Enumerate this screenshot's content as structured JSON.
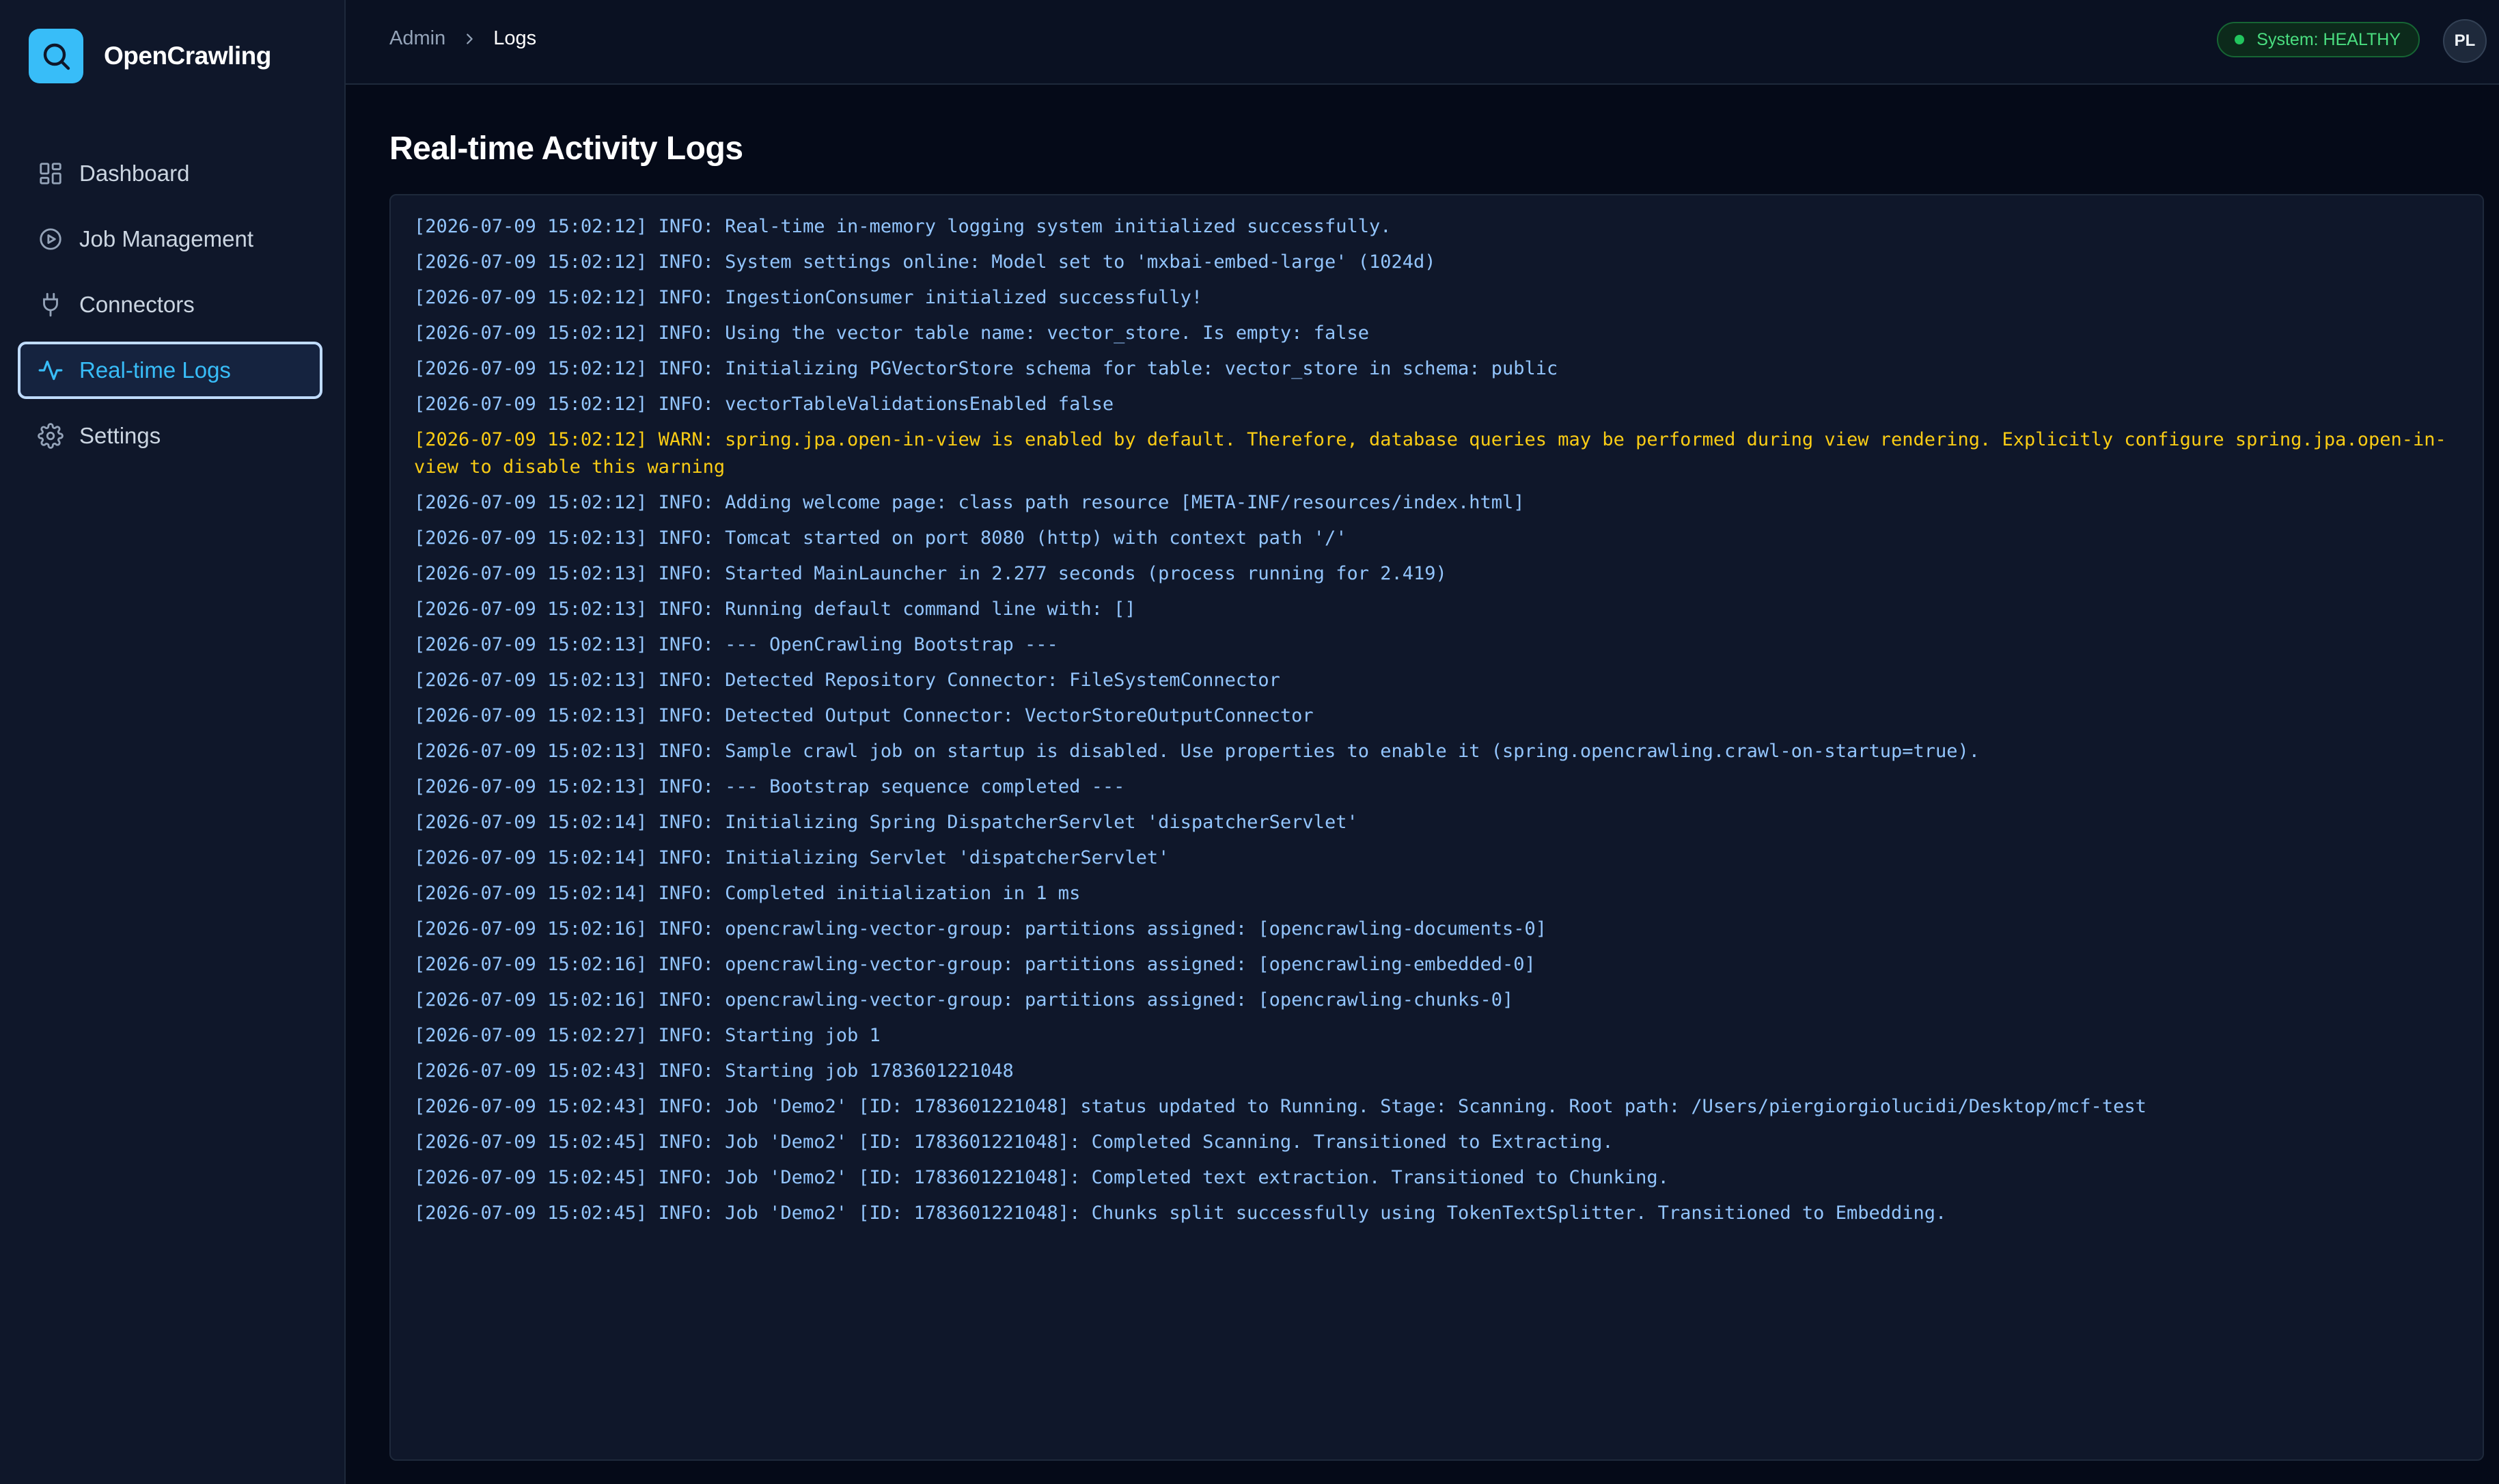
{
  "app": {
    "name": "OpenCrawling",
    "logo_icon": "search-icon",
    "accent_color": "#38bdf8"
  },
  "sidebar": {
    "items": [
      {
        "label": "Dashboard",
        "icon": "dashboard-icon",
        "active": false
      },
      {
        "label": "Job Management",
        "icon": "play-circle-icon",
        "active": false
      },
      {
        "label": "Connectors",
        "icon": "plug-icon",
        "active": false
      },
      {
        "label": "Real-time Logs",
        "icon": "activity-icon",
        "active": true
      },
      {
        "label": "Settings",
        "icon": "gear-icon",
        "active": false
      }
    ]
  },
  "header": {
    "breadcrumb": {
      "parent": "Admin",
      "current": "Logs"
    },
    "status": {
      "label": "System: HEALTHY",
      "color": "#22c55e"
    },
    "avatar_initials": "PL"
  },
  "main": {
    "title": "Real-time Activity Logs"
  },
  "logs": [
    {
      "level": "INFO",
      "text": "[2026-07-09 15:02:12] INFO: Real-time in-memory logging system initialized successfully."
    },
    {
      "level": "INFO",
      "text": "[2026-07-09 15:02:12] INFO: System settings online: Model set to 'mxbai-embed-large' (1024d)"
    },
    {
      "level": "INFO",
      "text": "[2026-07-09 15:02:12] INFO: IngestionConsumer initialized successfully!"
    },
    {
      "level": "INFO",
      "text": "[2026-07-09 15:02:12] INFO: Using the vector table name: vector_store. Is empty: false"
    },
    {
      "level": "INFO",
      "text": "[2026-07-09 15:02:12] INFO: Initializing PGVectorStore schema for table: vector_store in schema: public"
    },
    {
      "level": "INFO",
      "text": "[2026-07-09 15:02:12] INFO: vectorTableValidationsEnabled false"
    },
    {
      "level": "WARN",
      "text": "[2026-07-09 15:02:12] WARN: spring.jpa.open-in-view is enabled by default. Therefore, database queries may be performed during view rendering. Explicitly configure spring.jpa.open-in-view to disable this warning"
    },
    {
      "level": "INFO",
      "text": "[2026-07-09 15:02:12] INFO: Adding welcome page: class path resource [META-INF/resources/index.html]"
    },
    {
      "level": "INFO",
      "text": "[2026-07-09 15:02:13] INFO: Tomcat started on port 8080 (http) with context path '/'"
    },
    {
      "level": "INFO",
      "text": "[2026-07-09 15:02:13] INFO: Started MainLauncher in 2.277 seconds (process running for 2.419)"
    },
    {
      "level": "INFO",
      "text": "[2026-07-09 15:02:13] INFO: Running default command line with: []"
    },
    {
      "level": "INFO",
      "text": "[2026-07-09 15:02:13] INFO: --- OpenCrawling Bootstrap ---"
    },
    {
      "level": "INFO",
      "text": "[2026-07-09 15:02:13] INFO: Detected Repository Connector: FileSystemConnector"
    },
    {
      "level": "INFO",
      "text": "[2026-07-09 15:02:13] INFO: Detected Output Connector: VectorStoreOutputConnector"
    },
    {
      "level": "INFO",
      "text": "[2026-07-09 15:02:13] INFO: Sample crawl job on startup is disabled. Use properties to enable it (spring.opencrawling.crawl-on-startup=true)."
    },
    {
      "level": "INFO",
      "text": "[2026-07-09 15:02:13] INFO: --- Bootstrap sequence completed ---"
    },
    {
      "level": "INFO",
      "text": "[2026-07-09 15:02:14] INFO: Initializing Spring DispatcherServlet 'dispatcherServlet'"
    },
    {
      "level": "INFO",
      "text": "[2026-07-09 15:02:14] INFO: Initializing Servlet 'dispatcherServlet'"
    },
    {
      "level": "INFO",
      "text": "[2026-07-09 15:02:14] INFO: Completed initialization in 1 ms"
    },
    {
      "level": "INFO",
      "text": "[2026-07-09 15:02:16] INFO: opencrawling-vector-group: partitions assigned: [opencrawling-documents-0]"
    },
    {
      "level": "INFO",
      "text": "[2026-07-09 15:02:16] INFO: opencrawling-vector-group: partitions assigned: [opencrawling-embedded-0]"
    },
    {
      "level": "INFO",
      "text": "[2026-07-09 15:02:16] INFO: opencrawling-vector-group: partitions assigned: [opencrawling-chunks-0]"
    },
    {
      "level": "INFO",
      "text": "[2026-07-09 15:02:27] INFO: Starting job 1"
    },
    {
      "level": "INFO",
      "text": "[2026-07-09 15:02:43] INFO: Starting job 1783601221048"
    },
    {
      "level": "INFO",
      "text": "[2026-07-09 15:02:43] INFO: Job 'Demo2' [ID: 1783601221048] status updated to Running. Stage: Scanning. Root path: /Users/piergiorgiolucidi/Desktop/mcf-test"
    },
    {
      "level": "INFO",
      "text": "[2026-07-09 15:02:45] INFO: Job 'Demo2' [ID: 1783601221048]: Completed Scanning. Transitioned to Extracting."
    },
    {
      "level": "INFO",
      "text": "[2026-07-09 15:02:45] INFO: Job 'Demo2' [ID: 1783601221048]: Completed text extraction. Transitioned to Chunking."
    },
    {
      "level": "INFO",
      "text": "[2026-07-09 15:02:45] INFO: Job 'Demo2' [ID: 1783601221048]: Chunks split successfully using TokenTextSplitter. Transitioned to Embedding."
    }
  ]
}
